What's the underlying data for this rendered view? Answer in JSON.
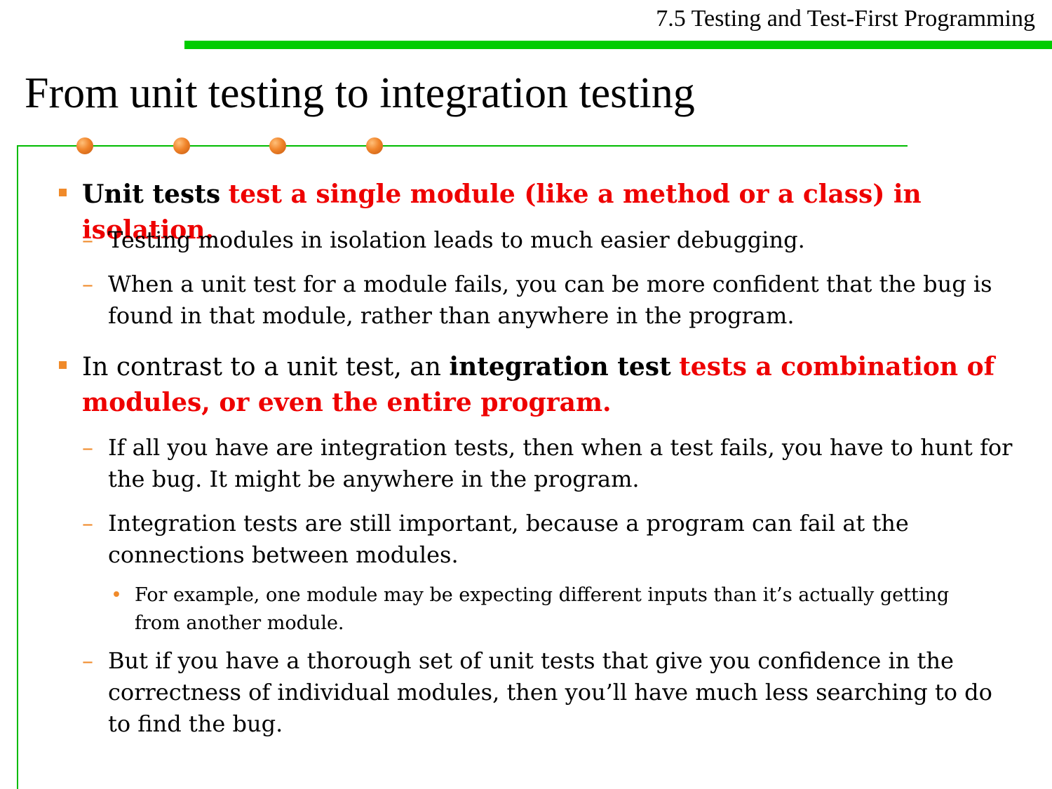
{
  "header": {
    "title": "7.5 Testing and Test-First Programming",
    "accent_color": "#00cc00"
  },
  "slide": {
    "title": "From unit testing to integration testing",
    "decoration": "four orange bullet dots on green frame line",
    "bullet_color": "#f08a2a",
    "highlight_color": "#ee0000"
  },
  "content": {
    "b1": {
      "term": "Unit tests",
      "highlight": "test a single module (like a method or a class) in isolation."
    },
    "b1_s1": "Testing modules in isolation leads to much easier debugging.",
    "b1_s2": "When a unit test for a module fails, you can be more confident that the bug is found in that module, rather than anywhere in the program.",
    "b2": {
      "prefix": "In contrast to a unit test, an",
      "term": "integration test",
      "highlight": "tests a combination of modules, or even the entire program."
    },
    "b2_s1": "If all you have are integration tests, then when a test fails, you have to hunt for the bug. It might be anywhere in the program.",
    "b2_s2": "Integration tests are still important, because a program can fail at the connections between modules.",
    "b2_s2_1": "For example, one module may be expecting different inputs than it’s actually getting from another module.",
    "b2_s3": "But if you have a thorough set of unit tests that give you confidence in the correctness of individual modules, then you’ll have much less searching to do to find the bug."
  }
}
